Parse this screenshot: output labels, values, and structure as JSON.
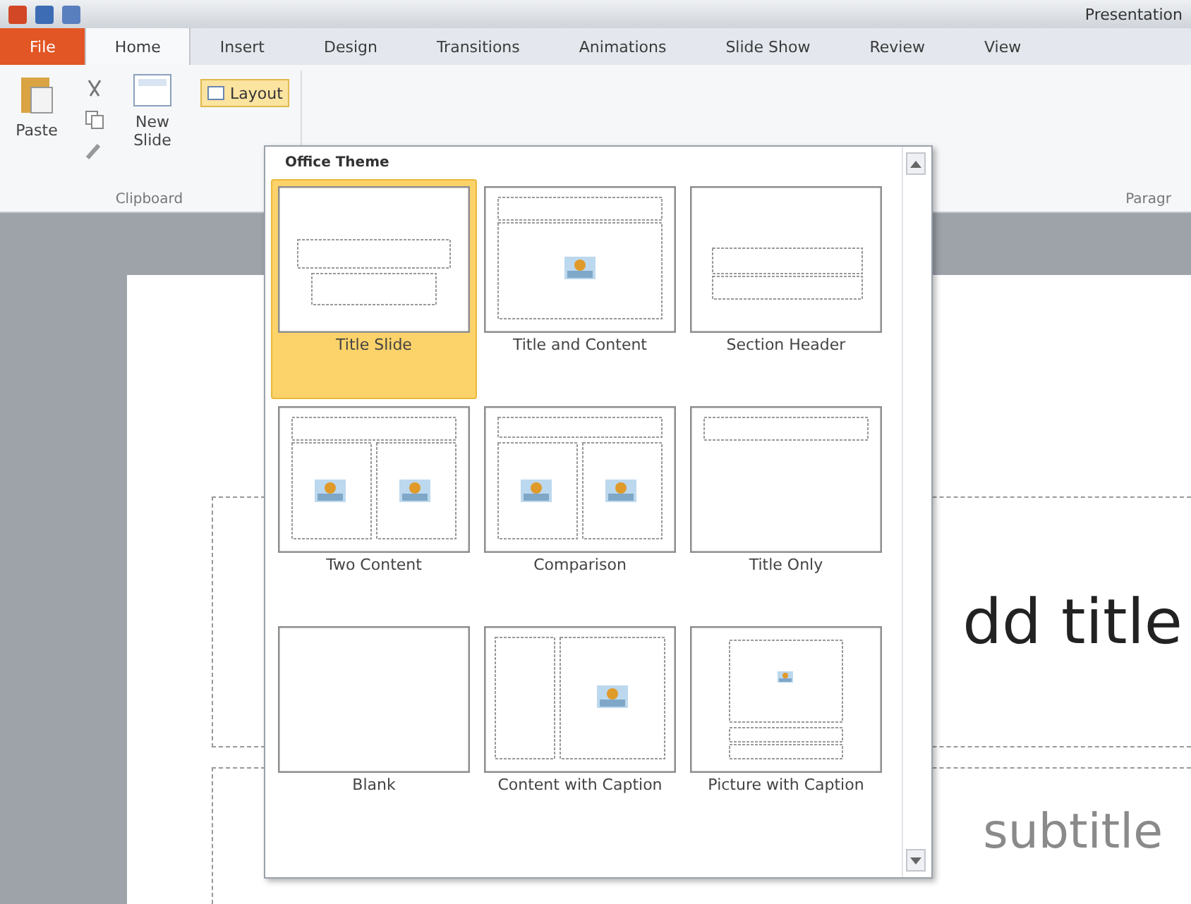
{
  "window": {
    "title": "Presentation"
  },
  "tabs": [
    {
      "label": "File",
      "kind": "file",
      "selected": false
    },
    {
      "label": "Home",
      "kind": "tab",
      "selected": true
    },
    {
      "label": "Insert",
      "kind": "tab",
      "selected": false
    },
    {
      "label": "Design",
      "kind": "tab",
      "selected": false
    },
    {
      "label": "Transitions",
      "kind": "tab",
      "selected": false
    },
    {
      "label": "Animations",
      "kind": "tab",
      "selected": false
    },
    {
      "label": "Slide Show",
      "kind": "tab",
      "selected": false
    },
    {
      "label": "Review",
      "kind": "tab",
      "selected": false
    },
    {
      "label": "View",
      "kind": "tab",
      "selected": false
    }
  ],
  "ribbon": {
    "paste_label": "Paste",
    "new_slide_label": "New Slide",
    "layout_button": {
      "label": "Layout",
      "open": true
    },
    "groups": [
      "Clipboard",
      "Paragr"
    ]
  },
  "layout_gallery": {
    "title": "Office Theme",
    "layouts": [
      {
        "label": "Title Slide",
        "kind": "title",
        "selected": true
      },
      {
        "label": "Title and Content",
        "kind": "title-content",
        "selected": false
      },
      {
        "label": "Section Header",
        "kind": "section",
        "selected": false
      },
      {
        "label": "Two Content",
        "kind": "two-content",
        "selected": false
      },
      {
        "label": "Comparison",
        "kind": "comparison",
        "selected": false
      },
      {
        "label": "Title Only",
        "kind": "title-only",
        "selected": false
      },
      {
        "label": "Blank",
        "kind": "blank",
        "selected": false
      },
      {
        "label": "Content with Caption",
        "kind": "content-caption",
        "selected": false
      },
      {
        "label": "Picture with Caption",
        "kind": "picture-caption",
        "selected": false
      }
    ]
  },
  "slide": {
    "title_placeholder": "dd title",
    "subtitle_placeholder": "subtitle"
  }
}
